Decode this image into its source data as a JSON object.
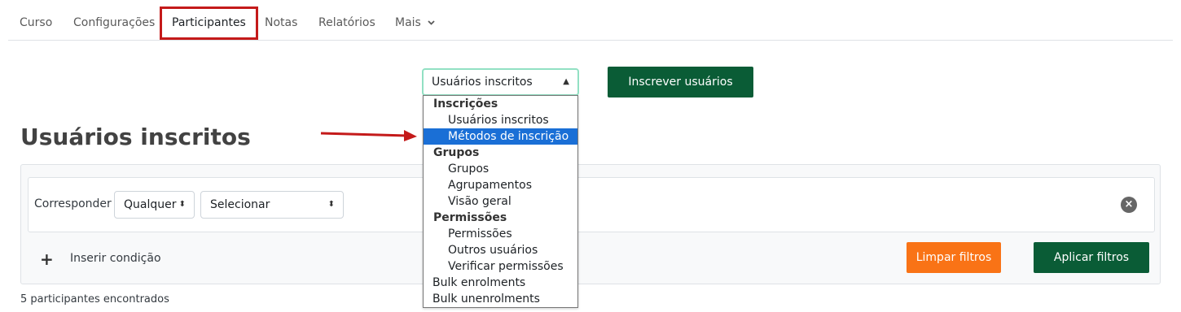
{
  "nav": {
    "tabs": [
      "Curso",
      "Configurações",
      "Participantes",
      "Notas",
      "Relatórios",
      "Mais"
    ],
    "active": "Participantes"
  },
  "header": {
    "select_value": "Usuários inscritos",
    "enrol_button": "Inscrever usuários"
  },
  "page_title": "Usuários inscritos",
  "filter": {
    "match_label": "Corresponder",
    "match_value": "Qualquer",
    "field_value": "Selecionar",
    "add_condition": "Inserir condição",
    "clear_button": "Limpar filtros",
    "apply_button": "Aplicar filtros"
  },
  "count_text": "5 participantes encontrados",
  "dropdown": {
    "groups": [
      {
        "label": "Inscrições",
        "items": [
          "Usuários inscritos",
          "Métodos de inscrição"
        ]
      },
      {
        "label": "Grupos",
        "items": [
          "Grupos",
          "Agrupamentos",
          "Visão geral"
        ]
      },
      {
        "label": "Permissões",
        "items": [
          "Permissões",
          "Outros usuários",
          "Verificar permissões"
        ]
      }
    ],
    "extra": [
      "Bulk enrolments",
      "Bulk unenrolments"
    ],
    "selected": "Métodos de inscrição"
  },
  "colors": {
    "primary_green": "#0a5c36",
    "orange": "#f97316",
    "highlight_red": "#c41a1a",
    "selected_blue": "#1a6fd6"
  }
}
